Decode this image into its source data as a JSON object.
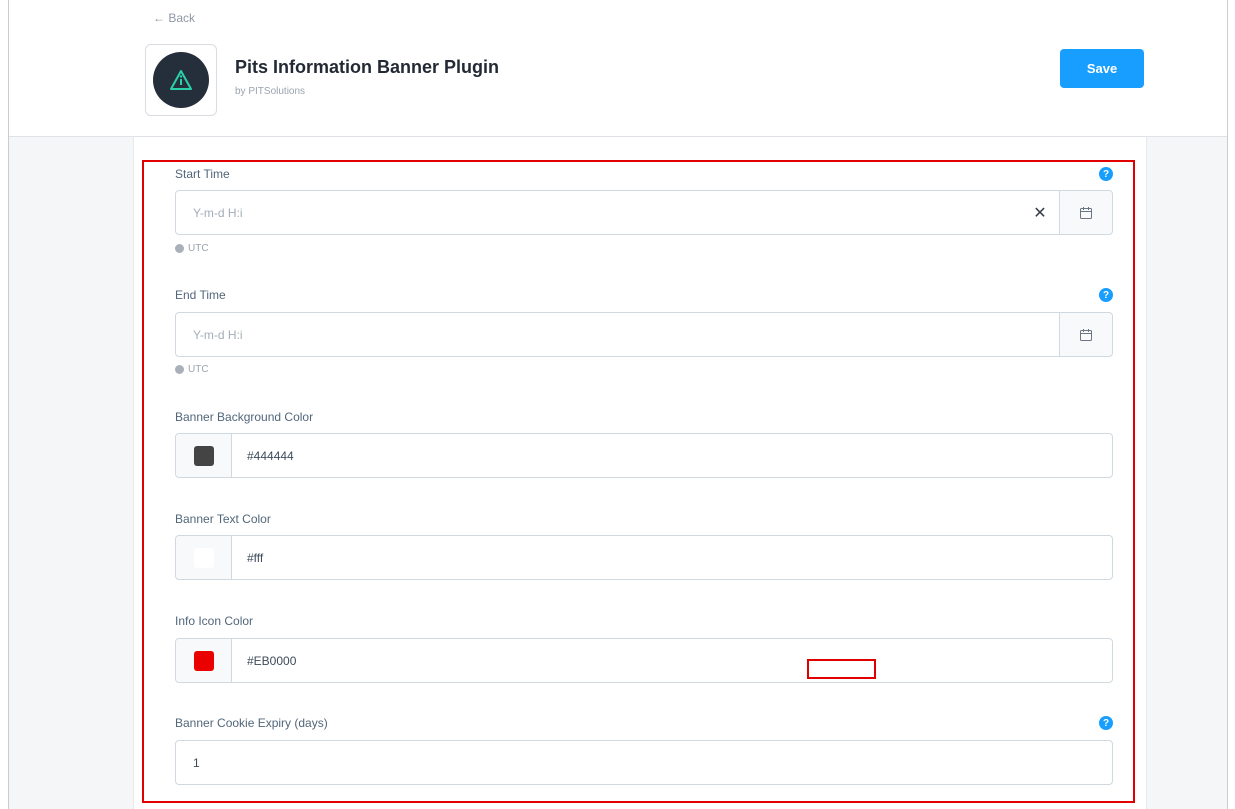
{
  "header": {
    "back_label": "← Back",
    "plugin_title": "Pits Information Banner Plugin",
    "plugin_author": "by PITSolutions",
    "save_label": "Save",
    "logo_icon": "warning-info-icon"
  },
  "fields": {
    "start_time": {
      "label": "Start Time",
      "placeholder": "Y-m-d H:i",
      "value": "",
      "timezone": "UTC",
      "help": "?"
    },
    "end_time": {
      "label": "End Time",
      "placeholder": "Y-m-d H:i",
      "value": "",
      "timezone": "UTC",
      "help": "?"
    },
    "banner_background_color": {
      "label": "Banner Background Color",
      "value": "#444444",
      "swatch": "#444444"
    },
    "banner_text_color": {
      "label": "Banner Text Color",
      "value": "#fff",
      "swatch": "#ffffff"
    },
    "info_icon_color": {
      "label": "Info Icon Color",
      "value": "#EB0000",
      "swatch": "#EB0000"
    },
    "banner_cookie_expiry": {
      "label": "Banner Cookie Expiry (days)",
      "value": "1",
      "help": "?"
    }
  },
  "colors": {
    "accent": "#189EFF",
    "highlight": "#E00000"
  }
}
